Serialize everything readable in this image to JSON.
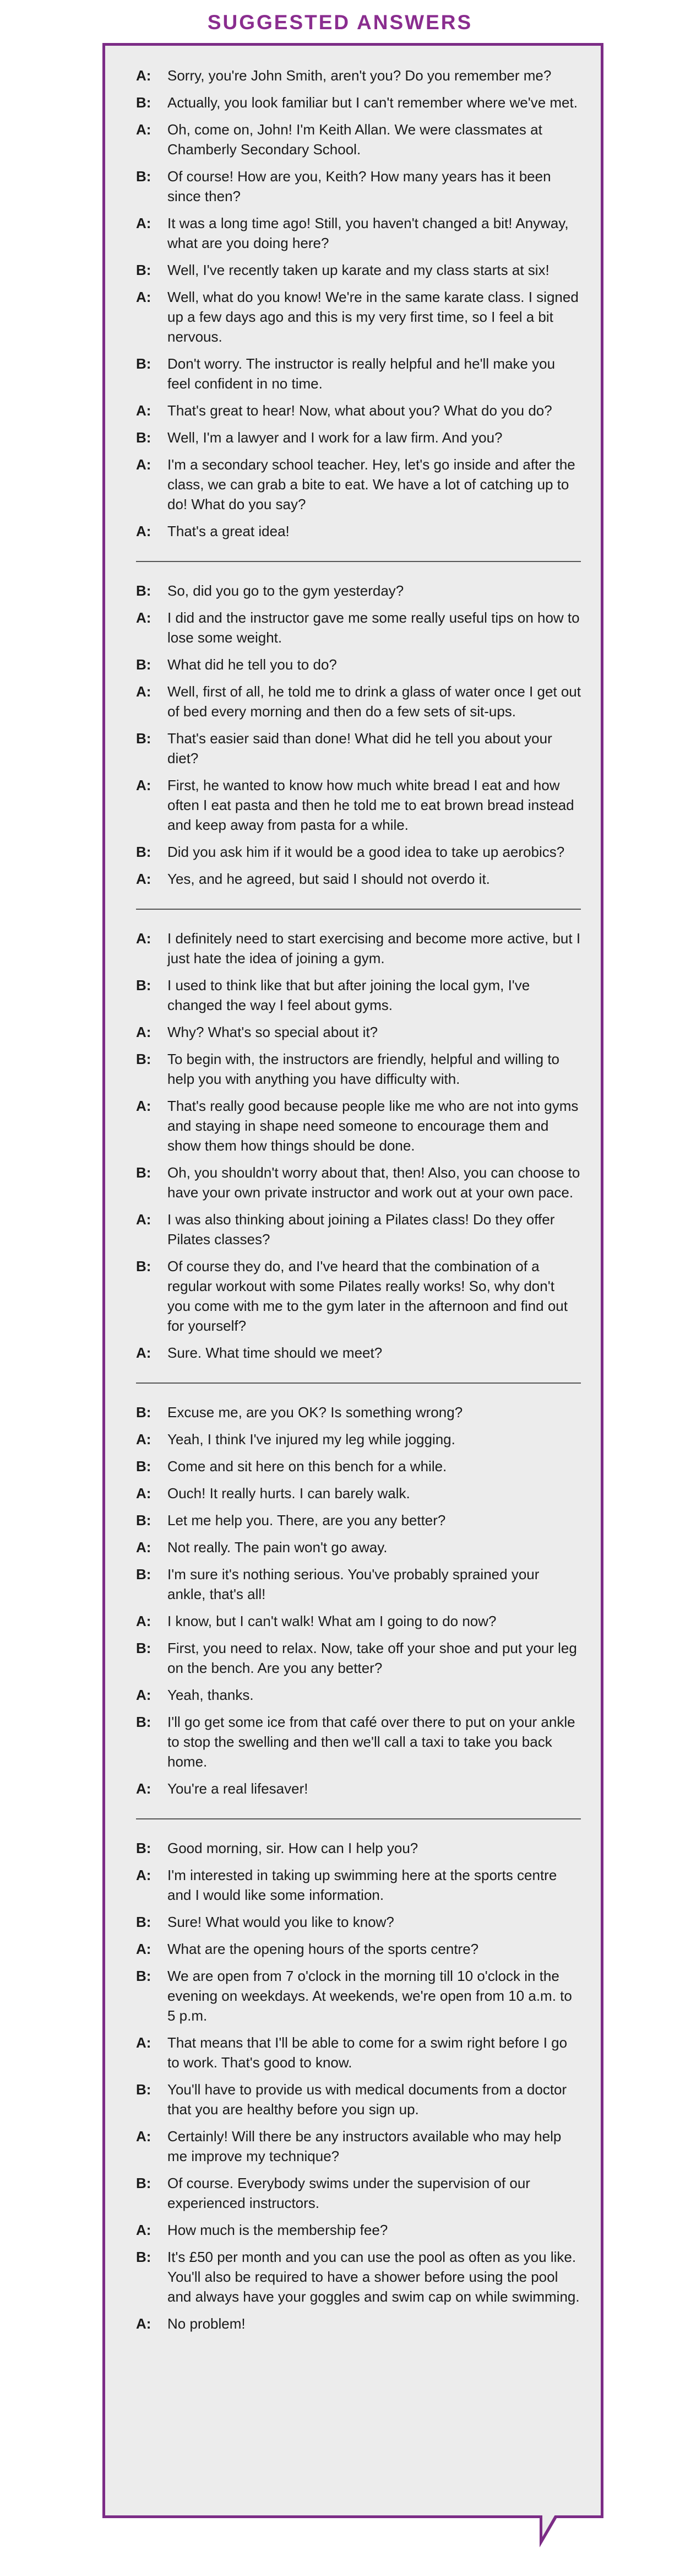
{
  "title": "SUGGESTED ANSWERS",
  "colors": {
    "accent": "#7c2c86",
    "panel_bg": "#ececec"
  },
  "sections": [
    {
      "lines": [
        {
          "speaker": "A:",
          "text": "Sorry, you're John Smith, aren't you? Do you remember me?"
        },
        {
          "speaker": "B:",
          "text": "Actually, you look familiar but I can't remember where we've met."
        },
        {
          "speaker": "A:",
          "text": "Oh, come on, John! I'm Keith Allan. We were classmates at Chamberly Secondary School."
        },
        {
          "speaker": "B:",
          "text": "Of course! How are you, Keith? How many years has it been since then?"
        },
        {
          "speaker": "A:",
          "text": "It was a long time ago! Still, you haven't changed a bit! Anyway, what are you doing here?"
        },
        {
          "speaker": "B:",
          "text": "Well, I've recently taken up karate and my class starts at six!"
        },
        {
          "speaker": "A:",
          "text": "Well, what do you know! We're in the same karate class. I signed up a few days ago and this is my very first time, so I feel a bit nervous."
        },
        {
          "speaker": "B:",
          "text": "Don't worry. The instructor is really helpful and he'll make you feel confident in no time."
        },
        {
          "speaker": "A:",
          "text": "That's great to hear! Now, what about you? What do you do?"
        },
        {
          "speaker": "B:",
          "text": "Well, I'm a lawyer and I work for a law firm. And you?"
        },
        {
          "speaker": "A:",
          "text": "I'm a secondary school teacher. Hey, let's go inside and after the class, we can grab a bite to eat. We have a lot of catching up to do! What do you say?"
        },
        {
          "speaker": "A:",
          "text": "That's a great idea!"
        }
      ]
    },
    {
      "lines": [
        {
          "speaker": "B:",
          "text": "So, did you go to the gym yesterday?"
        },
        {
          "speaker": "A:",
          "text": "I did and the instructor gave me some really useful tips on how to lose some weight."
        },
        {
          "speaker": "B:",
          "text": "What did he tell you to do?"
        },
        {
          "speaker": "A:",
          "text": "Well, first of all, he told me to drink a glass of water once I get out of bed every morning and then do a few sets of sit-ups."
        },
        {
          "speaker": "B:",
          "text": "That's easier said than done! What did he tell you about your diet?"
        },
        {
          "speaker": "A:",
          "text": "First, he wanted to know how much white bread I eat and how often I eat pasta and then he told me to eat brown bread instead and keep away from pasta for a while."
        },
        {
          "speaker": "B:",
          "text": "Did you ask him if it would be a good idea to take up aerobics?"
        },
        {
          "speaker": "A:",
          "text": "Yes, and he agreed, but said I should not overdo it."
        }
      ]
    },
    {
      "lines": [
        {
          "speaker": "A:",
          "text": "I definitely need to start exercising and become more active, but I just hate the idea of joining a gym."
        },
        {
          "speaker": "B:",
          "text": "I used to think like that but after joining the local gym, I've changed the way I feel about gyms."
        },
        {
          "speaker": "A:",
          "text": "Why? What's so special about it?"
        },
        {
          "speaker": "B:",
          "text": "To begin with, the instructors are friendly, helpful and willing to help you with anything you have difficulty with."
        },
        {
          "speaker": "A:",
          "text": "That's really good because people like me who are not into gyms and staying in shape need someone to encourage them and show them how things should be done."
        },
        {
          "speaker": "B:",
          "text": "Oh, you shouldn't worry about that, then! Also, you can choose to have your own private instructor and work out at your own pace."
        },
        {
          "speaker": "A:",
          "text": "I was also thinking about joining a Pilates class! Do they offer Pilates classes?"
        },
        {
          "speaker": "B:",
          "text": "Of course they do, and I've heard that the combination of a regular workout with some Pilates really works! So, why don't you come with me to the gym later in the afternoon and find out for yourself?"
        },
        {
          "speaker": "A:",
          "text": "Sure. What time should we meet?"
        }
      ]
    },
    {
      "lines": [
        {
          "speaker": "B:",
          "text": "Excuse me, are you OK? Is something wrong?"
        },
        {
          "speaker": "A:",
          "text": "Yeah, I think I've injured my leg while jogging."
        },
        {
          "speaker": "B:",
          "text": "Come and sit here on this bench for a while."
        },
        {
          "speaker": "A:",
          "text": "Ouch! It really hurts. I can barely walk."
        },
        {
          "speaker": "B:",
          "text": "Let me help you. There, are you any better?"
        },
        {
          "speaker": "A:",
          "text": "Not really. The pain won't go away."
        },
        {
          "speaker": "B:",
          "text": "I'm sure it's nothing serious. You've probably sprained your ankle, that's all!"
        },
        {
          "speaker": "A:",
          "text": "I know, but I can't walk! What am I going to do now?"
        },
        {
          "speaker": "B:",
          "text": "First, you need to relax. Now, take off your shoe and put your leg on the bench. Are you any better?"
        },
        {
          "speaker": "A:",
          "text": "Yeah, thanks."
        },
        {
          "speaker": "B:",
          "text": "I'll go get some ice from that café over there to put on your ankle to stop the swelling and then we'll call a taxi to take you back home."
        },
        {
          "speaker": "A:",
          "text": "You're a real lifesaver!"
        }
      ]
    },
    {
      "lines": [
        {
          "speaker": "B:",
          "text": "Good morning, sir. How can I help you?"
        },
        {
          "speaker": "A:",
          "text": "I'm interested in taking up swimming here at the sports centre and I would like some information."
        },
        {
          "speaker": "B:",
          "text": "Sure! What would you like to know?"
        },
        {
          "speaker": "A:",
          "text": "What are the opening hours of the sports centre?"
        },
        {
          "speaker": "B:",
          "text": "We are open from 7 o'clock in the morning till 10 o'clock in the evening on weekdays. At weekends, we're open from 10 a.m. to 5 p.m."
        },
        {
          "speaker": "A:",
          "text": "That means that I'll be able to come for a swim right before I go to work. That's good to know."
        },
        {
          "speaker": "B:",
          "text": "You'll have to provide us with medical documents from a doctor that you are healthy before you sign up."
        },
        {
          "speaker": "A:",
          "text": "Certainly! Will there be any instructors available who may help me improve my technique?"
        },
        {
          "speaker": "B:",
          "text": "Of course. Everybody swims under the supervision of our experienced instructors."
        },
        {
          "speaker": "A:",
          "text": "How much is the membership fee?"
        },
        {
          "speaker": "B:",
          "text": "It's £50 per month and you can use the pool as often as you like. You'll also be required to have a shower before using the pool and always have your goggles and swim cap on while swimming."
        },
        {
          "speaker": "A:",
          "text": "No problem!"
        }
      ]
    }
  ]
}
